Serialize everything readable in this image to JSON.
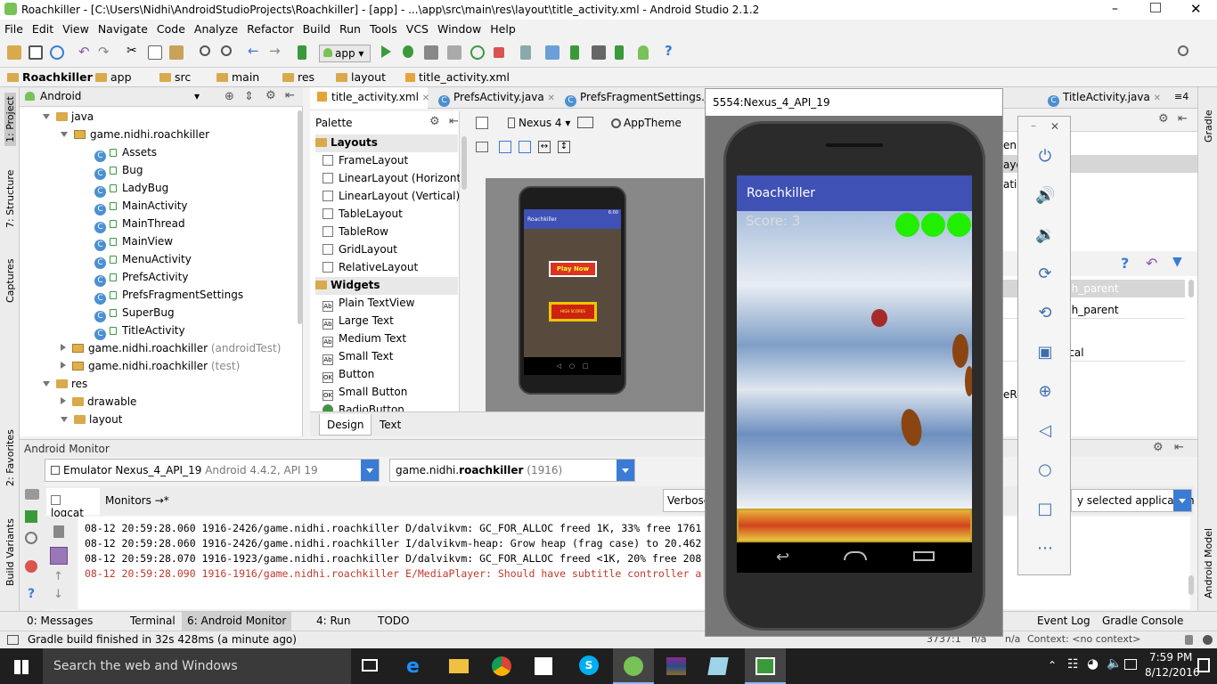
{
  "window": {
    "title": "Roachkiller - [C:\\Users\\Nidhi\\AndroidStudioProjects\\Roachkiller] - [app] - ...\\app\\src\\main\\res\\layout\\title_activity.xml - Android Studio 2.1.2"
  },
  "menu": [
    "File",
    "Edit",
    "View",
    "Navigate",
    "Code",
    "Analyze",
    "Refactor",
    "Build",
    "Run",
    "Tools",
    "VCS",
    "Window",
    "Help"
  ],
  "toolbar": {
    "run_config": "app"
  },
  "breadcrumb": [
    "Roachkiller",
    "app",
    "src",
    "main",
    "res",
    "layout",
    "title_activity.xml"
  ],
  "left_strip": {
    "project": "1: Project",
    "structure": "7: Structure",
    "captures": "Captures",
    "favorites": "2: Favorites",
    "build_variants": "Build Variants"
  },
  "project": {
    "view": "Android",
    "tree": [
      {
        "label": "java",
        "kind": "folder",
        "expanded": true,
        "level": 1
      },
      {
        "label": "game.nidhi.roachkiller",
        "kind": "package",
        "expanded": true,
        "level": 2
      },
      {
        "label": "Assets",
        "kind": "class",
        "level": 3
      },
      {
        "label": "Bug",
        "kind": "class",
        "level": 3
      },
      {
        "label": "LadyBug",
        "kind": "class",
        "level": 3
      },
      {
        "label": "MainActivity",
        "kind": "class",
        "level": 3
      },
      {
        "label": "MainThread",
        "kind": "class",
        "level": 3
      },
      {
        "label": "MainView",
        "kind": "class",
        "level": 3
      },
      {
        "label": "MenuActivity",
        "kind": "class",
        "level": 3
      },
      {
        "label": "PrefsActivity",
        "kind": "class",
        "level": 3
      },
      {
        "label": "PrefsFragmentSettings",
        "kind": "class",
        "level": 3
      },
      {
        "label": "SuperBug",
        "kind": "class",
        "level": 3
      },
      {
        "label": "TitleActivity",
        "kind": "class",
        "level": 3
      },
      {
        "label": "game.nidhi.roachkiller",
        "suffix": "(androidTest)",
        "kind": "package",
        "expanded": false,
        "level": 2
      },
      {
        "label": "game.nidhi.roachkiller",
        "suffix": "(test)",
        "kind": "package",
        "expanded": false,
        "level": 2
      },
      {
        "label": "res",
        "kind": "folder",
        "expanded": true,
        "level": 1
      },
      {
        "label": "drawable",
        "kind": "folder",
        "expanded": false,
        "level": 2
      },
      {
        "label": "layout",
        "kind": "folder",
        "expanded": true,
        "level": 2
      }
    ]
  },
  "editor_tabs": [
    "title_activity.xml",
    "PrefsActivity.java",
    "PrefsFragmentSettings.java"
  ],
  "right_tabs": [
    "TitleActivity.java"
  ],
  "palette": {
    "title": "Palette",
    "items": [
      {
        "label": "Layouts",
        "category": true
      },
      {
        "label": "FrameLayout"
      },
      {
        "label": "LinearLayout (Horizontal)"
      },
      {
        "label": "LinearLayout (Vertical)"
      },
      {
        "label": "TableLayout"
      },
      {
        "label": "TableRow"
      },
      {
        "label": "GridLayout"
      },
      {
        "label": "RelativeLayout"
      },
      {
        "label": "Widgets",
        "category": true
      },
      {
        "label": "Plain TextView",
        "icon": "Ab"
      },
      {
        "label": "Large Text",
        "icon": "Ab"
      },
      {
        "label": "Medium Text",
        "icon": "Ab"
      },
      {
        "label": "Small Text",
        "icon": "Ab"
      },
      {
        "label": "Button",
        "icon": "OK"
      },
      {
        "label": "Small Button",
        "icon": "OK"
      },
      {
        "label": "RadioButton",
        "icon": "rb"
      }
    ]
  },
  "designer": {
    "device": "Nexus 4",
    "theme": "AppTheme",
    "preview_app": "Roachkiller",
    "preview_time": "6:00",
    "play_now": "Play Now",
    "high_scores": "HIGH SCORES"
  },
  "design_tabs": [
    "Design",
    "Text"
  ],
  "monitor": {
    "title": "Android Monitor",
    "device": "Emulator Nexus_4_API_19",
    "device_detail": "Android 4.4.2, API 19",
    "process_prefix": "game.nidhi.",
    "process_bold": "roachkiller",
    "process_pid": "(1916)",
    "tabs": [
      "logcat",
      "Monitors"
    ],
    "level": "Verbose",
    "filter": "y selected application"
  },
  "log": [
    {
      "text": "08-12 20:59:28.060 1916-2426/game.nidhi.roachkiller D/dalvikvm: GC_FOR_ALLOC freed 1K, 33% free 1761",
      "color": "#000000"
    },
    {
      "text": "08-12 20:59:28.060 1916-2426/game.nidhi.roachkiller I/dalvikvm-heap: Grow heap (frag case) to 20.462",
      "color": "#000000"
    },
    {
      "text": "08-12 20:59:28.070 1916-1923/game.nidhi.roachkiller D/dalvikvm: GC_FOR_ALLOC freed <1K, 20% free 208",
      "color": "#000000"
    },
    {
      "text": "08-12 20:59:28.090 1916-1916/game.nidhi.roachkiller E/MediaPlayer: Should have subtitle controller a",
      "color": "#c0392b"
    }
  ],
  "bottom_tools": [
    {
      "label": "0: Messages",
      "key": "0"
    },
    {
      "label": "Terminal"
    },
    {
      "label": "6: Android Monitor",
      "key": "6"
    },
    {
      "label": "4: Run",
      "key": "4"
    },
    {
      "label": "TODO"
    },
    {
      "label": "Event Log"
    },
    {
      "label": "Gradle Console"
    }
  ],
  "status": {
    "message": "Gradle build finished in 32s 428ms (a minute ago)",
    "position": "3737:1",
    "na": "n/a",
    "context": "Context: <no context>"
  },
  "right_strip": {
    "gradle": "Gradle",
    "android_model": "Android Model"
  },
  "properties": {
    "row1": "ch_parent",
    "row2": "ch_parent",
    "row3": "ical",
    "partial1": "en",
    "partial2": "ayo",
    "partial3": "ativ",
    "partial4": "eRe"
  },
  "emulator": {
    "title": "5554:Nexus_4_API_19",
    "app_title": "Roachkiller",
    "score": "Score: 3",
    "lives": 3
  },
  "taskbar": {
    "search": "Search the web and Windows",
    "time": "7:59 PM",
    "date": "8/12/2016"
  },
  "colors": {
    "accent": "#3a7bd5",
    "app_bar": "#3f51b5",
    "life": "#22ee00",
    "error": "#c0392b"
  }
}
